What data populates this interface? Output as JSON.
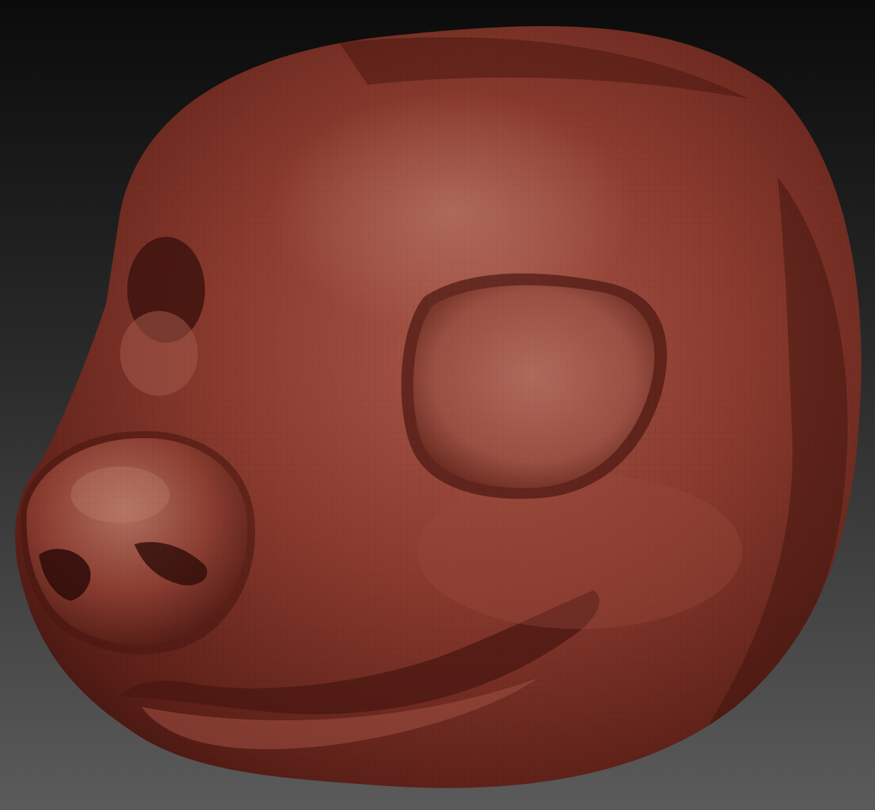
{
  "viewport": {
    "background_top": "#0b0b0b",
    "background_bottom": "#5b5b5b"
  },
  "model": {
    "subject": "sculpted-animal-head",
    "material_color": "#8a3a2e",
    "highlight_color": "#b77467",
    "shadow_color": "#3f140f",
    "wireframe_visible": true
  }
}
